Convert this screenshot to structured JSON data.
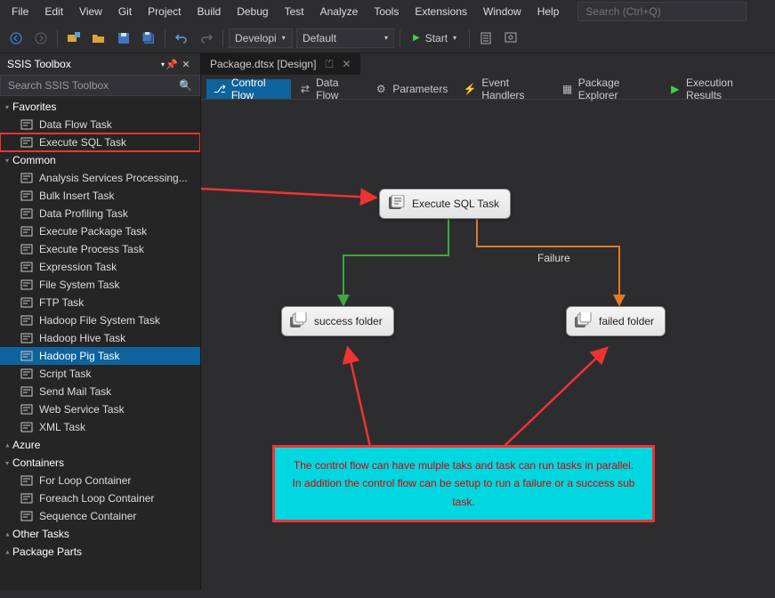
{
  "menu": {
    "items": [
      "File",
      "Edit",
      "View",
      "Git",
      "Project",
      "Build",
      "Debug",
      "Test",
      "Analyze",
      "Tools",
      "Extensions",
      "Window",
      "Help"
    ],
    "search_placeholder": "Search (Ctrl+Q)"
  },
  "toolbar": {
    "config": "Developi",
    "platform": "Default",
    "start": "Start"
  },
  "toolbox": {
    "title": "SSIS Toolbox",
    "search_placeholder": "Search SSIS Toolbox",
    "groups": [
      {
        "name": "Favorites",
        "expanded": true,
        "items": [
          {
            "label": "Data Flow Task"
          },
          {
            "label": "Execute SQL Task",
            "boxed": true
          }
        ]
      },
      {
        "name": "Common",
        "expanded": true,
        "items": [
          {
            "label": "Analysis Services Processing..."
          },
          {
            "label": "Bulk Insert Task"
          },
          {
            "label": "Data Profiling Task"
          },
          {
            "label": "Execute Package Task"
          },
          {
            "label": "Execute Process Task"
          },
          {
            "label": "Expression Task"
          },
          {
            "label": "File System Task"
          },
          {
            "label": "FTP Task"
          },
          {
            "label": "Hadoop File System Task"
          },
          {
            "label": "Hadoop Hive Task"
          },
          {
            "label": "Hadoop Pig Task",
            "selected": true
          },
          {
            "label": "Script Task"
          },
          {
            "label": "Send Mail Task"
          },
          {
            "label": "Web Service Task"
          },
          {
            "label": "XML Task"
          }
        ]
      },
      {
        "name": "Azure",
        "expanded": false,
        "items": []
      },
      {
        "name": "Containers",
        "expanded": true,
        "items": [
          {
            "label": "For Loop Container"
          },
          {
            "label": "Foreach Loop Container"
          },
          {
            "label": "Sequence Container"
          }
        ]
      },
      {
        "name": "Other Tasks",
        "expanded": false,
        "items": []
      },
      {
        "name": "Package Parts",
        "expanded": false,
        "items": []
      }
    ]
  },
  "document": {
    "tab": "Package.dtsx [Design]"
  },
  "design_tabs": [
    {
      "label": "Control Flow",
      "active": true
    },
    {
      "label": "Data Flow"
    },
    {
      "label": "Parameters"
    },
    {
      "label": "Event Handlers"
    },
    {
      "label": "Package Explorer"
    },
    {
      "label": "Execution Results"
    }
  ],
  "tasks": {
    "exec_sql": "Execute SQL Task",
    "success": "success folder",
    "failed": "failed folder"
  },
  "edge_labels": {
    "failure": "Failure"
  },
  "annotation": "The control flow can have mulple taks and task can run tasks in parallel.  In addition the control flow can be setup to run a failure or a success sub task.",
  "colors": {
    "accent": "#0e639c",
    "success": "#3fa83f",
    "failure": "#e07a28",
    "anno_bg": "#00d7e0",
    "anno_border": "#e33"
  }
}
